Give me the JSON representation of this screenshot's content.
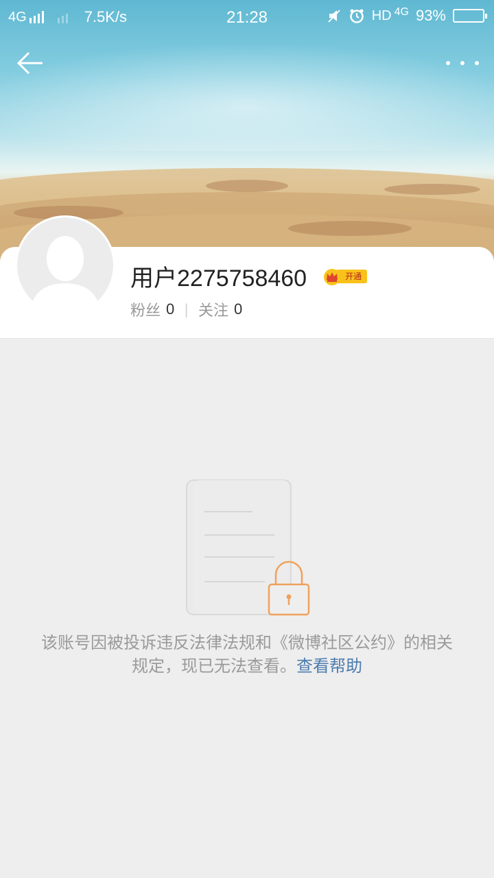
{
  "status_bar": {
    "network": "4G",
    "speed": "7.5K/s",
    "time": "21:28",
    "hd_label": "HD",
    "network_right": "4G",
    "battery": "93%",
    "battery_level": 0.93
  },
  "nav": {
    "back_icon": "back-arrow-icon",
    "more_icon": "more-dots-icon"
  },
  "profile": {
    "username": "用户2275758460",
    "vip_label": "开通",
    "followers_label": "粉丝",
    "followers_count": "0",
    "following_label": "关注",
    "following_count": "0",
    "separator": "|"
  },
  "notice": {
    "text": "该账号因被投诉违反法律法规和《微博社区公约》的相关规定，现已无法查看。",
    "link": "查看帮助"
  },
  "colors": {
    "link": "#4c7cb0",
    "lock": "#f0a15c",
    "vip_badge": "#f9c21b",
    "page_bg": "#eeeeee"
  }
}
